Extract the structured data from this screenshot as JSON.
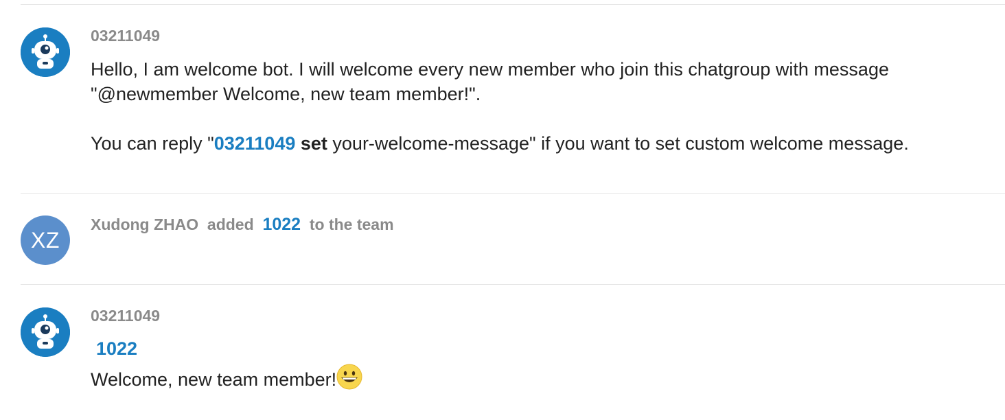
{
  "messages": [
    {
      "author": "03211049",
      "avatar_icon": "bot-icon",
      "line1": "Hello, I am welcome bot. I will welcome every new member who join this chatgroup with message",
      "line2": "\"@newmember Welcome, new team member!\".",
      "reply_prefix": "You can reply \"",
      "reply_mention": "03211049",
      "reply_command": "set",
      "reply_suffix": " your-welcome-message\" if you want to set custom welcome message."
    },
    {
      "avatar_initials": "XZ",
      "actor": "Xudong ZHAO",
      "verb": "added",
      "target": "1022",
      "suffix": "to the team"
    },
    {
      "author": "03211049",
      "avatar_icon": "bot-icon",
      "mention": "1022",
      "text": "Welcome, new team member!",
      "emoji_icon": "grinning-face-icon"
    }
  ],
  "colors": {
    "accent": "#1a7ec1",
    "initials_avatar": "#5b8fcc",
    "muted": "#8a8a8a",
    "text": "#222222",
    "divider": "#e6e6e6"
  }
}
